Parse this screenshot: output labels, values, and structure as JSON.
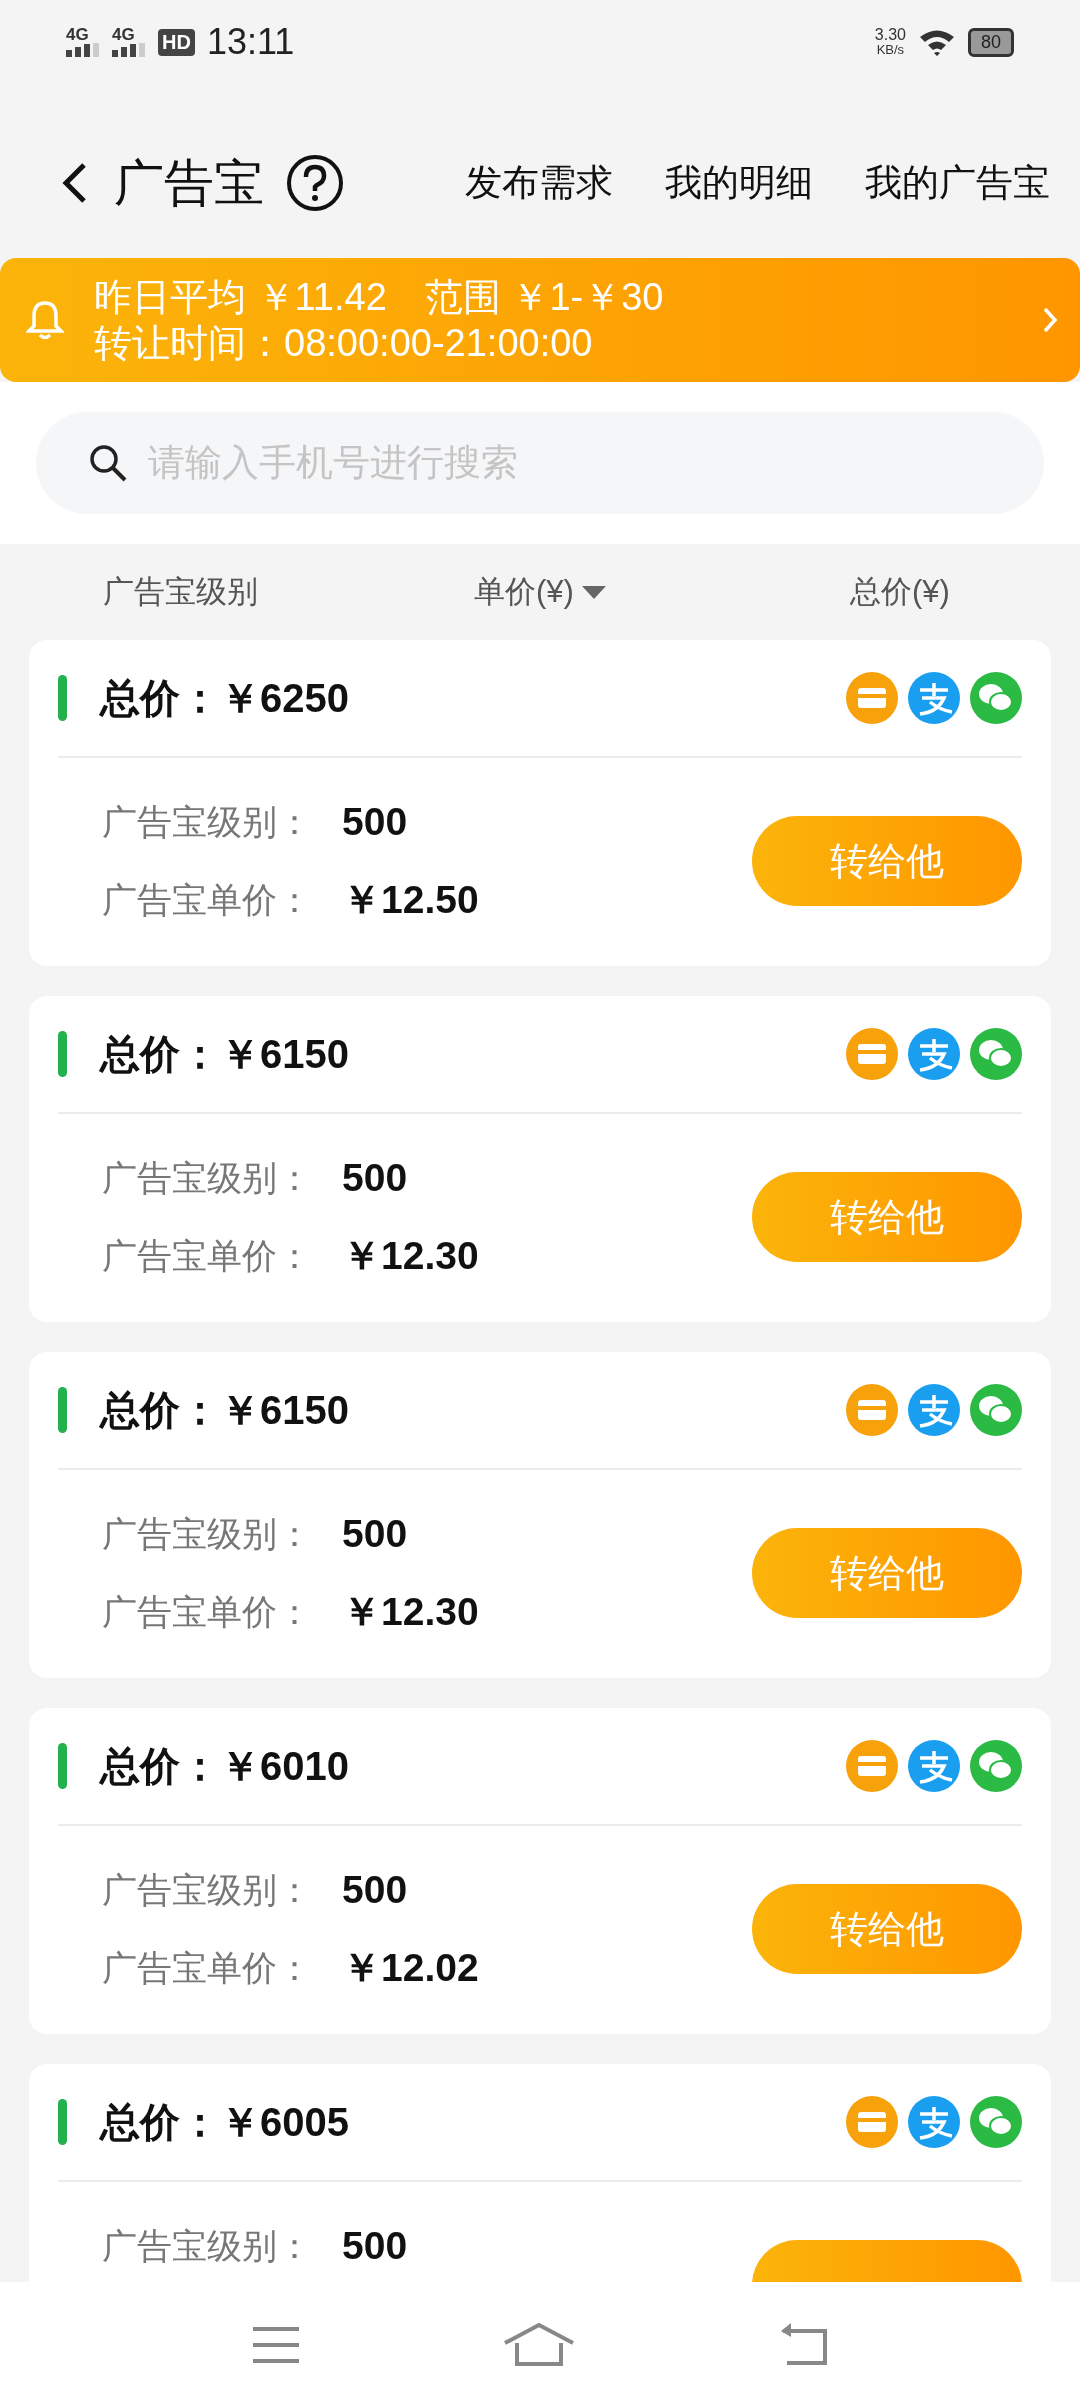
{
  "status_bar": {
    "networks": [
      "4G",
      "4G"
    ],
    "hd": "HD",
    "time": "13:11",
    "speed": "3.30",
    "speed_unit": "KB/s",
    "battery": "80"
  },
  "header": {
    "title": "广告宝",
    "tabs": [
      "发布需求",
      "我的明细",
      "我的广告宝"
    ]
  },
  "notice": {
    "line1": "昨日平均 ￥11.42　范围 ￥1-￥30",
    "line2": "转让时间：08:00:00-21:00:00"
  },
  "search": {
    "placeholder": "请输入手机号进行搜索"
  },
  "columns": [
    {
      "label": "广告宝级别",
      "sorted": false
    },
    {
      "label": "单价(¥)",
      "sorted": true
    },
    {
      "label": "总价(¥)",
      "sorted": false
    }
  ],
  "listings": [
    {
      "total": "总价：￥6250",
      "level_label": "广告宝级别：",
      "level": "500",
      "price_label": "广告宝单价：",
      "price": "￥12.50",
      "action": "转给他"
    },
    {
      "total": "总价：￥6150",
      "level_label": "广告宝级别：",
      "level": "500",
      "price_label": "广告宝单价：",
      "price": "￥12.30",
      "action": "转给他"
    },
    {
      "total": "总价：￥6150",
      "level_label": "广告宝级别：",
      "level": "500",
      "price_label": "广告宝单价：",
      "price": "￥12.30",
      "action": "转给他"
    },
    {
      "total": "总价：￥6010",
      "level_label": "广告宝级别：",
      "level": "500",
      "price_label": "广告宝单价：",
      "price": "￥12.02",
      "action": "转给他"
    },
    {
      "total": "总价：￥6005",
      "level_label": "广告宝级别：",
      "level": "500"
    }
  ]
}
